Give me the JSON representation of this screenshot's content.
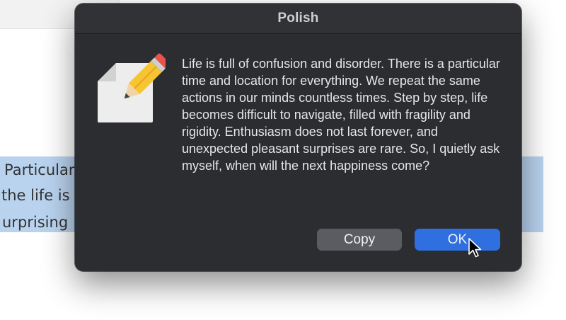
{
  "background_document": {
    "lines": [
      "Particular",
      "the life is",
      "urprising"
    ]
  },
  "dialog": {
    "title": "Polish",
    "icon": "pencil-paper-icon",
    "message": "Life is full of confusion and disorder. There is a particular time and location for everything. We repeat the same actions in our minds countless times. Step by step, life becomes difficult to navigate, filled with fragility and rigidity. Enthusiasm does not last forever, and unexpected pleasant surprises are rare. So, I quietly ask myself, when will the next happiness come?",
    "buttons": {
      "copy_label": "Copy",
      "ok_label": "OK"
    }
  },
  "colors": {
    "dialog_bg": "#2c2d30",
    "accent": "#2f6fe0",
    "selection": "#b9d3ef"
  }
}
